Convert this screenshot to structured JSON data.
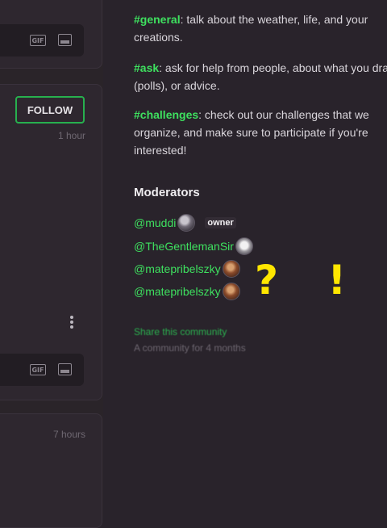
{
  "feed": {
    "gif_label": "GIF",
    "follow_label": "FOLLOW",
    "post_time_1": "1 hour",
    "post_time_2": "7 hours"
  },
  "sidebar": {
    "channels": [
      {
        "tag": "#general",
        "text": ": talk about the weather, life, and your creations."
      },
      {
        "tag": "#ask",
        "text": ": ask for help from people, about what you draw (polls), or advice."
      },
      {
        "tag": "#challenges",
        "text": ": check out our challenges that we organize, and make sure to participate if you're interested!"
      }
    ],
    "moderators_title": "Moderators",
    "moderators": [
      {
        "name": "@muddi",
        "badge": "owner"
      },
      {
        "name": "@TheGentlemanSir"
      },
      {
        "name": "@matepribelszky"
      },
      {
        "name": "@matepribelszky"
      }
    ],
    "annotation": "? !",
    "share_label": "Share this community",
    "community_age": "A community for 4 months"
  },
  "colors": {
    "background": "#29232b",
    "accent_green": "#3ee05f",
    "annotation_yellow": "#ffe600"
  }
}
